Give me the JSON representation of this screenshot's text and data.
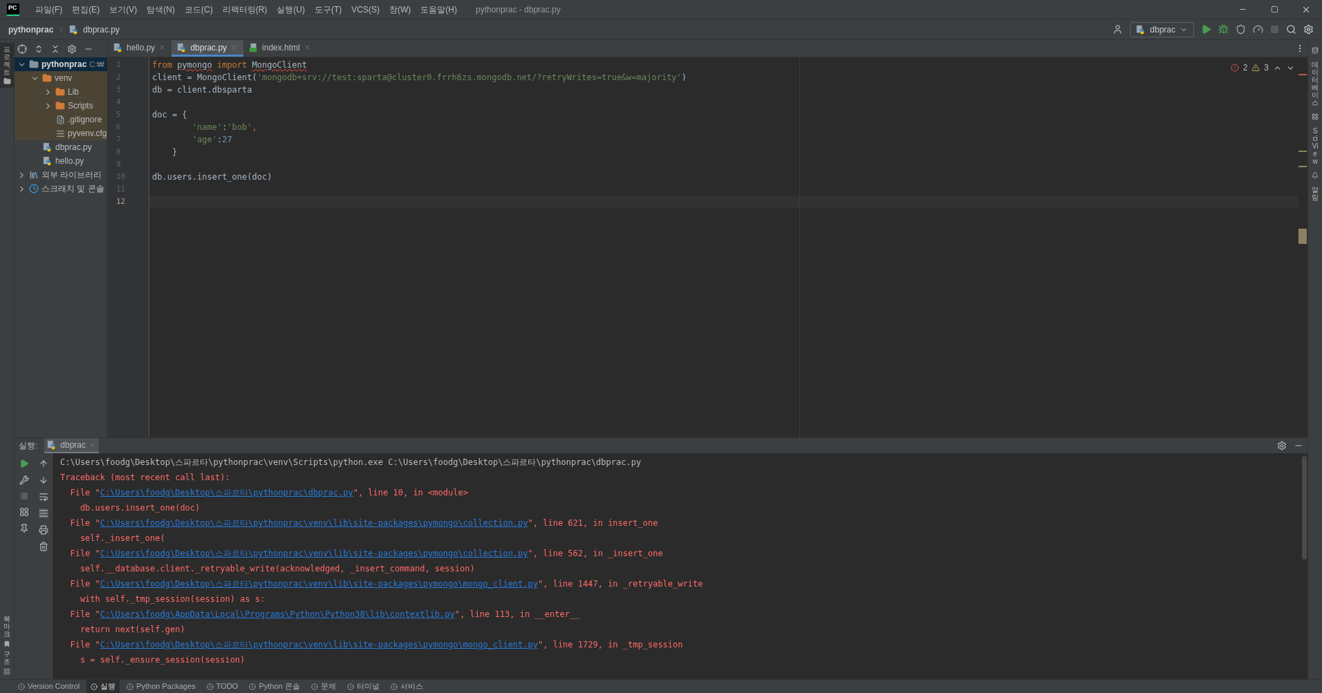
{
  "menu": {
    "logo": "PC",
    "items": [
      "파일(F)",
      "편집(E)",
      "보기(V)",
      "탐색(N)",
      "코드(C)",
      "리팩터링(R)",
      "실행(U)",
      "도구(T)",
      "VCS(S)",
      "창(W)",
      "도움말(H)"
    ],
    "title": "pythonprac - dbprac.py"
  },
  "breadcrumb": {
    "project": "pythonprac",
    "file": "dbprac.py"
  },
  "run_config": "dbprac",
  "left_strip": [
    "프로젝트",
    "북마크",
    "구조"
  ],
  "right_strip": [
    "데이터베이스",
    "SciView",
    "알림"
  ],
  "tree": [
    {
      "label": "pythonprac",
      "hint": "C:₩",
      "kind": "project",
      "expanded": true,
      "selected": true,
      "children": [
        {
          "label": "venv",
          "kind": "excluded",
          "expanded": true,
          "selected": false,
          "children": [
            {
              "label": "Lib",
              "kind": "excluded",
              "expanded": false,
              "selected": false
            },
            {
              "label": "Scripts",
              "kind": "excluded",
              "expanded": false,
              "selected": false
            },
            {
              "label": ".gitignore",
              "kind": "ignore",
              "selected": false
            },
            {
              "label": "pyvenv.cfg",
              "kind": "cfg",
              "selected": false
            }
          ]
        },
        {
          "label": "dbprac.py",
          "kind": "python",
          "selected": false
        },
        {
          "label": "hello.py",
          "kind": "python",
          "selected": false
        }
      ]
    },
    {
      "label": "외부 라이브러리",
      "kind": "library",
      "expanded": false,
      "selected": false
    },
    {
      "label": "스크래치 및 콘솔",
      "kind": "scratch",
      "expanded": false,
      "selected": false
    }
  ],
  "tabs": [
    {
      "label": "hello.py",
      "kind": "python",
      "selected": false
    },
    {
      "label": "dbprac.py",
      "kind": "python",
      "selected": true
    },
    {
      "label": "index.html",
      "kind": "html",
      "selected": false
    }
  ],
  "inspection": {
    "errors": "2",
    "warnings": "3"
  },
  "code": [
    {
      "number": "1",
      "tokens": [
        {
          "kind": "keyword",
          "text": "from "
        },
        {
          "kind": "plain",
          "text": "pymongo",
          "squiggle": true
        },
        {
          "kind": "keyword",
          "text": " import "
        },
        {
          "kind": "plain",
          "text": "MongoClient",
          "squiggle": true
        }
      ]
    },
    {
      "number": "2",
      "tokens": [
        {
          "kind": "plain",
          "text": "client = MongoClient("
        },
        {
          "kind": "string",
          "text": "'mongodb+srv://test:sparta@cluster0.frrh6zs.mongodb.net/?retryWrites=true&w=majority'"
        },
        {
          "kind": "plain",
          "text": ")"
        }
      ]
    },
    {
      "number": "3",
      "tokens": [
        {
          "kind": "plain",
          "text": "db = client.dbsparta"
        }
      ]
    },
    {
      "number": "4"
    },
    {
      "number": "5",
      "tokens": [
        {
          "kind": "plain",
          "text": "doc = {"
        }
      ]
    },
    {
      "number": "6",
      "tokens": [
        {
          "kind": "string",
          "text": "        'name'"
        },
        {
          "kind": "plain",
          "text": ":"
        },
        {
          "kind": "string",
          "text": "'bob'"
        },
        {
          "kind": "keyword",
          "text": ","
        }
      ]
    },
    {
      "number": "7",
      "tokens": [
        {
          "kind": "string",
          "text": "        'age'"
        },
        {
          "kind": "plain",
          "text": ":"
        },
        {
          "kind": "number",
          "text": "27"
        }
      ]
    },
    {
      "number": "8",
      "tokens": [
        {
          "kind": "plain",
          "text": "    }"
        }
      ]
    },
    {
      "number": "9"
    },
    {
      "number": "10",
      "tokens": [
        {
          "kind": "plain",
          "text": "db.users.insert_one(doc)"
        }
      ]
    },
    {
      "number": "11"
    },
    {
      "number": "12",
      "current": true
    }
  ],
  "run_panel": {
    "label": "실행:",
    "tab": "dbprac"
  },
  "console": [
    {
      "kind": "command",
      "text": "C:\\Users\\foodg\\Desktop\\스파르타\\pythonprac\\venv\\Scripts\\python.exe C:\\Users\\foodg\\Desktop\\스파르타\\pythonprac\\dbprac.py"
    },
    {
      "kind": "error",
      "text": "Traceback (most recent call last):"
    },
    {
      "kind": "file",
      "before": "  File \"",
      "link": "C:\\Users\\foodg\\Desktop\\스파르타\\pythonprac\\dbprac.py",
      "after": "\", line 10, in <module>"
    },
    {
      "kind": "error",
      "text": "    db.users.insert_one(doc)"
    },
    {
      "kind": "file",
      "before": "  File \"",
      "link": "C:\\Users\\foodg\\Desktop\\스파르타\\pythonprac\\venv\\lib\\site-packages\\pymongo\\collection.py",
      "after": "\", line 621, in insert_one"
    },
    {
      "kind": "error",
      "text": "    self._insert_one("
    },
    {
      "kind": "file",
      "before": "  File \"",
      "link": "C:\\Users\\foodg\\Desktop\\스파르타\\pythonprac\\venv\\lib\\site-packages\\pymongo\\collection.py",
      "after": "\", line 562, in _insert_one"
    },
    {
      "kind": "error",
      "text": "    self.__database.client._retryable_write(acknowledged, _insert_command, session)"
    },
    {
      "kind": "file",
      "before": "  File \"",
      "link": "C:\\Users\\foodg\\Desktop\\스파르타\\pythonprac\\venv\\lib\\site-packages\\pymongo\\mongo_client.py",
      "after": "\", line 1447, in _retryable_write"
    },
    {
      "kind": "error",
      "text": "    with self._tmp_session(session) as s:"
    },
    {
      "kind": "file",
      "before": "  File \"",
      "link": "C:\\Users\\foodg\\AppData\\Local\\Programs\\Python\\Python38\\lib\\contextlib.py",
      "after": "\", line 113, in __enter__"
    },
    {
      "kind": "error",
      "text": "    return next(self.gen)"
    },
    {
      "kind": "file",
      "before": "  File \"",
      "link": "C:\\Users\\foodg\\Desktop\\스파르타\\pythonprac\\venv\\lib\\site-packages\\pymongo\\mongo_client.py",
      "after": "\", line 1729, in _tmp_session"
    },
    {
      "kind": "error",
      "text": "    s = self._ensure_session(session)"
    }
  ],
  "status_tabs": [
    {
      "label": "Version Control",
      "selected": false
    },
    {
      "label": "실행",
      "selected": true
    },
    {
      "label": "Python Packages",
      "selected": false
    },
    {
      "label": "TODO",
      "selected": false
    },
    {
      "label": "Python 콘솔",
      "selected": false
    },
    {
      "label": "문제",
      "selected": false
    },
    {
      "label": "터미널",
      "selected": false
    },
    {
      "label": "서비스",
      "selected": false
    }
  ]
}
